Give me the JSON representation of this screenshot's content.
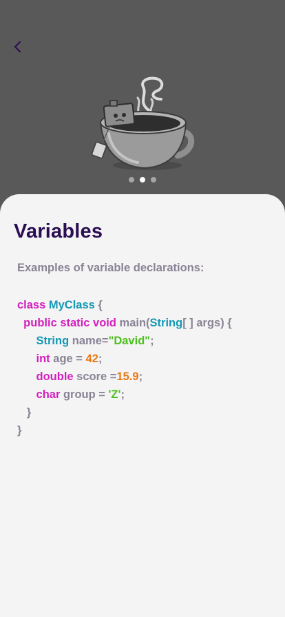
{
  "header": {
    "back_icon": "chevron-left-icon"
  },
  "hero": {
    "illustration": "robot-in-teacup-illustration",
    "pager": {
      "count": 3,
      "active_index": 1
    }
  },
  "content": {
    "title": "Variables",
    "subtitle": "Examples of variable declarations:",
    "code": {
      "l1": {
        "kw": "class",
        "sp": " ",
        "cls": "MyClass",
        "rest": " {"
      },
      "l2": {
        "indent": "  ",
        "mods": "public static void",
        "name": " main(",
        "type": "String",
        "rest": "[ ] args) {"
      },
      "l3": {
        "indent": "      ",
        "type": "String",
        "name": " name=",
        "val": "\"David\"",
        "end": ";"
      },
      "l4": {
        "indent": "      ",
        "type": "int",
        "name": " age = ",
        "val": "42",
        "end": ";"
      },
      "l5": {
        "indent": "      ",
        "type": "double",
        "name": " score =",
        "val": "15.9",
        "end": ";"
      },
      "l6": {
        "indent": "      ",
        "type": "char",
        "name": " group = ",
        "val": "'Z'",
        "end": ";"
      },
      "l7": {
        "text": "   }"
      },
      "l8": {
        "text": "}"
      }
    }
  },
  "colors": {
    "title": "#2b0d52",
    "keyword": "#d21fbd",
    "type": "#1597b5",
    "string": "#4bbf1c",
    "number": "#e87a16",
    "plain": "#8a8395"
  }
}
